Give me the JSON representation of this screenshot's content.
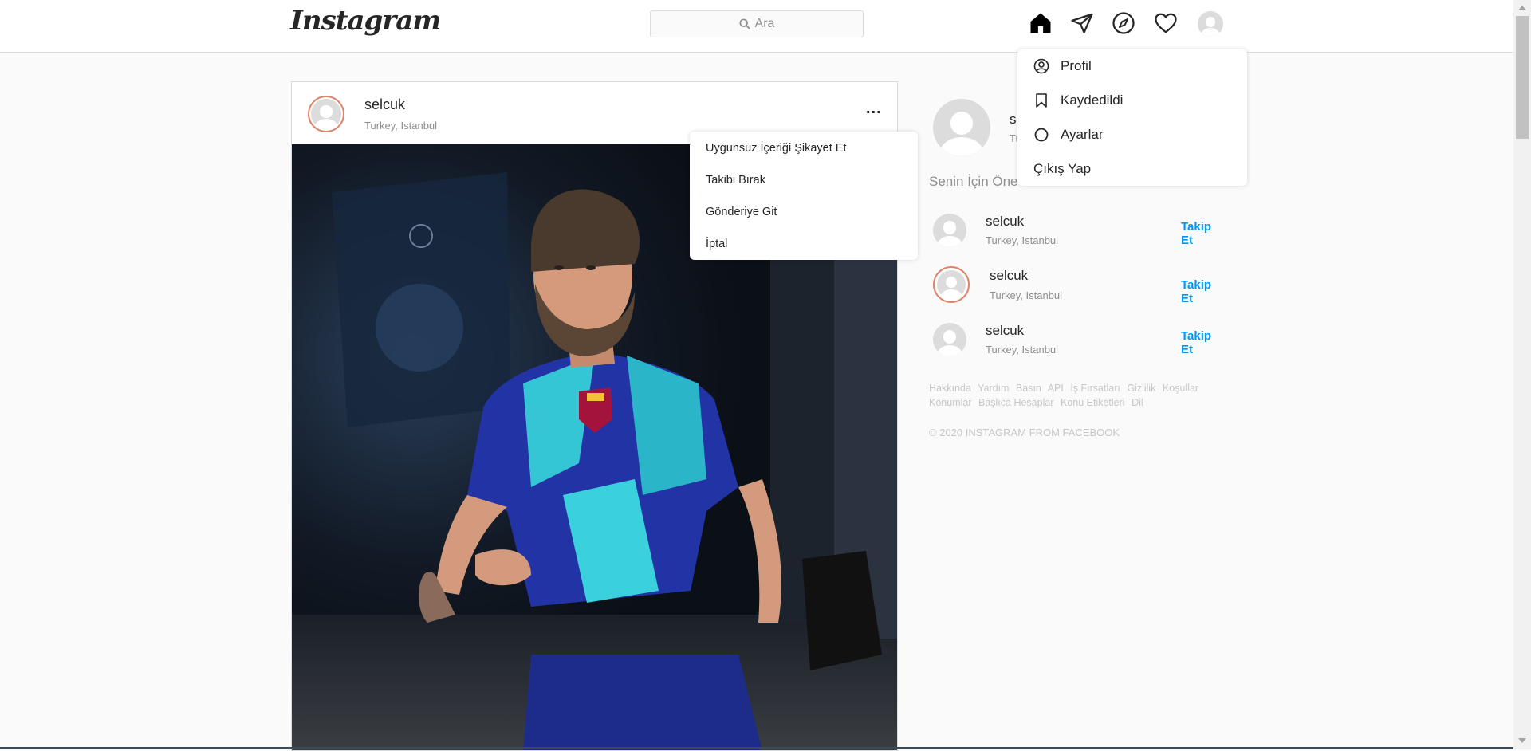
{
  "header": {
    "logo": "Instagram",
    "search_placeholder": "Ara",
    "icons": [
      "home-icon",
      "direct-icon",
      "explore-icon",
      "heart-icon",
      "profile-avatar"
    ]
  },
  "post": {
    "username": "selcuk",
    "location": "Turkey, Istanbul",
    "more": "..."
  },
  "post_menu": {
    "items": [
      "Uygunsuz İçeriği Şikayet Et",
      "Takibi Bırak",
      "Gönderiye Git",
      "İptal"
    ]
  },
  "profile_menu": {
    "items": [
      "Profil",
      "Kaydedildi",
      "Ayarlar",
      "Çıkış Yap"
    ]
  },
  "sidebar": {
    "me_name": "se",
    "me_sub": "Tu",
    "suggest_title": "Senin İçin Öne",
    "suggestions": [
      {
        "name": "selcuk",
        "location": "Turkey, Istanbul",
        "follow": "Takip Et"
      },
      {
        "name": "selcuk",
        "location": "Turkey, Istanbul",
        "follow": "Takip Et"
      },
      {
        "name": "selcuk",
        "location": "Turkey, Istanbul",
        "follow": "Takip Et"
      }
    ],
    "footer_links": [
      "Hakkında",
      "Yardım",
      "Basın",
      "API",
      "İş Fırsatları",
      "Gizlilik",
      "Koşullar",
      "Konumlar",
      "Başlıca Hesaplar",
      "Konu Etiketleri",
      "Dil"
    ],
    "copyright": "© 2020 INSTAGRAM FROM FACEBOOK"
  },
  "colors": {
    "link_blue": "#0095f6",
    "story_ring": "#e0826a",
    "muted": "#8e8e8e"
  }
}
